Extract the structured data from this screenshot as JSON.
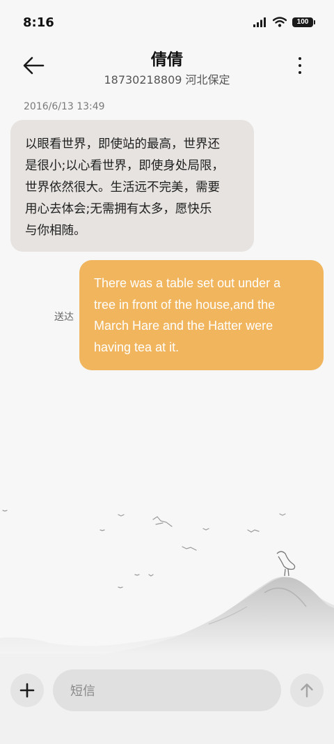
{
  "status_bar": {
    "time": "8:16",
    "battery": "100",
    "icons": [
      "signal-icon",
      "wifi-icon",
      "battery-icon"
    ]
  },
  "header": {
    "contact_name": "倩倩",
    "subtitle": "18730218809 河北保定",
    "back_icon": "arrow-left-icon",
    "more_icon": "more-vertical-icon"
  },
  "conversation": {
    "timestamp": "2016/6/13 13:49",
    "messages": [
      {
        "direction": "incoming",
        "lines": [
          "以眼看世界，即使站的最高，世界还",
          "是很小;以心看世界，即使身处局限，",
          "世界依然很大。生活远不完美，需要",
          "用心去体会;无需拥有太多，愿快乐",
          "与你相随。"
        ]
      },
      {
        "direction": "outgoing",
        "lines": [
          "There was a table set out under a",
          "tree in front of the house,and the",
          "March Hare and the Hatter were",
          "having tea at it."
        ],
        "status": "送达"
      }
    ]
  },
  "composer": {
    "placeholder": "短信",
    "add_icon": "plus-icon",
    "send_icon": "arrow-up-icon"
  },
  "colors": {
    "background": "#f7f7f7",
    "incoming_bubble": "#e6e3e0",
    "outgoing_bubble": "#f1b55d",
    "outgoing_text": "#ffffff",
    "input_bg": "#e0e0e0"
  }
}
